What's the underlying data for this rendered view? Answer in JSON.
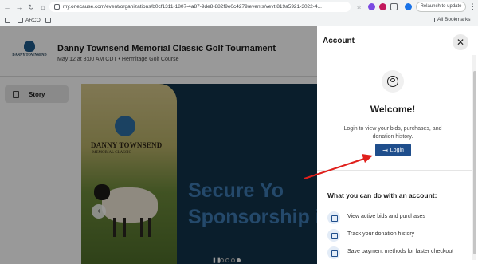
{
  "browser": {
    "url": "my.onecause.com/event/organizations/b0cf1311-1807-4a87-9de8-882f9e0c4279/events/vevt:819a5921-3022-4...",
    "relaunch_label": "Relaunch to update",
    "bookmarks": [
      "ARCO"
    ],
    "all_bookmarks_label": "All Bookmarks"
  },
  "event": {
    "logo_text": "DANNY TOWNSEND",
    "title": "Danny Townsend Memorial Classic Golf Tournament",
    "subtitle": "May 12 at 8:00 AM CDT • Hermitage Golf Course",
    "story_tab": "Story",
    "hero_brand": "DANNY TOWNSEND",
    "hero_brand_sub": "MEMORIAL CLASSIC",
    "hero_text_line1": "Secure Yo",
    "hero_text_line2": "Sponsorship i"
  },
  "drawer": {
    "title": "Account",
    "welcome": "Welcome!",
    "message": "Login to view your bids, purchases, and donation history.",
    "login_label": "Login",
    "features_title": "What you can do with an account:",
    "features": [
      {
        "icon": "gavel-icon",
        "text": "View active bids and purchases"
      },
      {
        "icon": "donation-icon",
        "text": "Track your donation history"
      },
      {
        "icon": "payment-icon",
        "text": "Save payment methods for faster checkout"
      }
    ]
  },
  "colors": {
    "primary": "#1f4e8c",
    "hero_bg": "#12324a",
    "hero_text": "#3d7bb3",
    "arrow": "#e0201c"
  }
}
